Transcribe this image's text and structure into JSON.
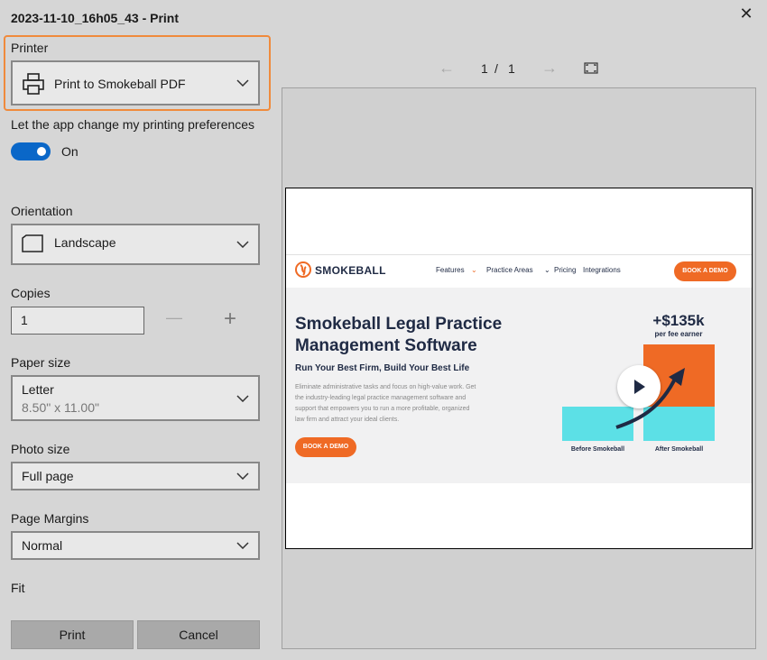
{
  "window": {
    "title": "2023-11-10_16h05_43 - Print"
  },
  "printer": {
    "label": "Printer",
    "value": "Print to Smokeball PDF"
  },
  "preferences": {
    "label": "Let the app change my printing preferences",
    "toggle_state": "On"
  },
  "orientation": {
    "label": "Orientation",
    "value": "Landscape"
  },
  "copies": {
    "label": "Copies",
    "value": "1",
    "minus": "—",
    "plus": "+"
  },
  "paper_size": {
    "label": "Paper size",
    "value": "Letter",
    "sub": "8.50\" x 11.00\""
  },
  "photo_size": {
    "label": "Photo size",
    "value": "Full page"
  },
  "margins": {
    "label": "Page Margins",
    "value": "Normal"
  },
  "fit": {
    "label": "Fit"
  },
  "actions": {
    "print": "Print",
    "cancel": "Cancel"
  },
  "preview": {
    "page_current": "1",
    "page_sep": "/",
    "page_total": "1",
    "site": {
      "brand": "SMOKEBALL",
      "nav": [
        "Features",
        "Practice Areas",
        "Pricing",
        "Integrations"
      ],
      "cta": "BOOK A DEMO",
      "headline_1": "Smokeball Legal Practice",
      "headline_2": "Management Software",
      "tagline": "Run Your Best Firm, Build Your Best Life",
      "body_1": "Eliminate administrative tasks and focus on high-value work. Get",
      "body_2": "the industry-leading legal practice management software and",
      "body_3": "support that empowers you to run a more profitable, organized",
      "body_4": "law firm and attract your ideal clients.",
      "cta2": "BOOK A DEMO",
      "stat": "+$135k",
      "stat_sub": "per fee earner",
      "bar_before": "Before Smokeball",
      "bar_after": "After Smokeball"
    }
  },
  "colors": {
    "accent_blue": "#0a67c8",
    "focus_orange": "#f08a3c",
    "brand_orange": "#ef6a25",
    "brand_cyan": "#5ce0e6",
    "navy": "#1f2a44"
  }
}
